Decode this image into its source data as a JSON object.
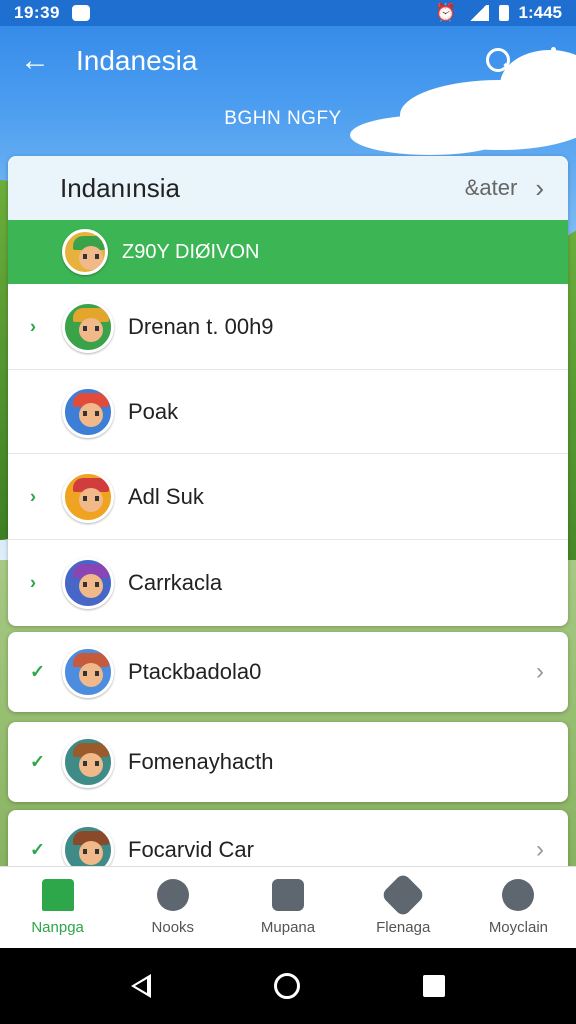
{
  "status_bar": {
    "time": "19:39",
    "battery_text": "1:445"
  },
  "app_bar": {
    "title": "Indanesia",
    "subtitle": "BGHN NGFY"
  },
  "card": {
    "header": "Indanınsia",
    "later_label": "&ater",
    "banner": "Z90Y DIØIVON",
    "items": [
      {
        "name": "Drenan t. 00h9",
        "avatar_color": "#3aa34a",
        "hat_color": "#e3a52b"
      },
      {
        "name": "Poak",
        "avatar_color": "#3d7fd6",
        "hat_color": "#e14b3a"
      },
      {
        "name": "Adl Suk",
        "avatar_color": "#f0a321",
        "hat_color": "#d13c3c"
      },
      {
        "name": "Carrkacla",
        "avatar_color": "#4667c8",
        "hat_color": "#8a45b5"
      }
    ]
  },
  "singles": [
    {
      "name": "Ptackbadola0",
      "avatar_color": "#4c8de0",
      "hat_color": "#c65a3c"
    },
    {
      "name": "Fomenayhacth",
      "avatar_color": "#3e8b87",
      "hat_color": "#9b5a2c"
    },
    {
      "name": "Focarvid Car",
      "avatar_color": "#3e8b87",
      "hat_color": "#8a4a2a"
    }
  ],
  "bottom_nav": [
    {
      "label": "Nanpga"
    },
    {
      "label": "Nooks"
    },
    {
      "label": "Mupana"
    },
    {
      "label": "Flenaga"
    },
    {
      "label": "Moyclain"
    }
  ],
  "colors": {
    "primary": "#1f6fd0",
    "accent_green": "#3cb554"
  }
}
